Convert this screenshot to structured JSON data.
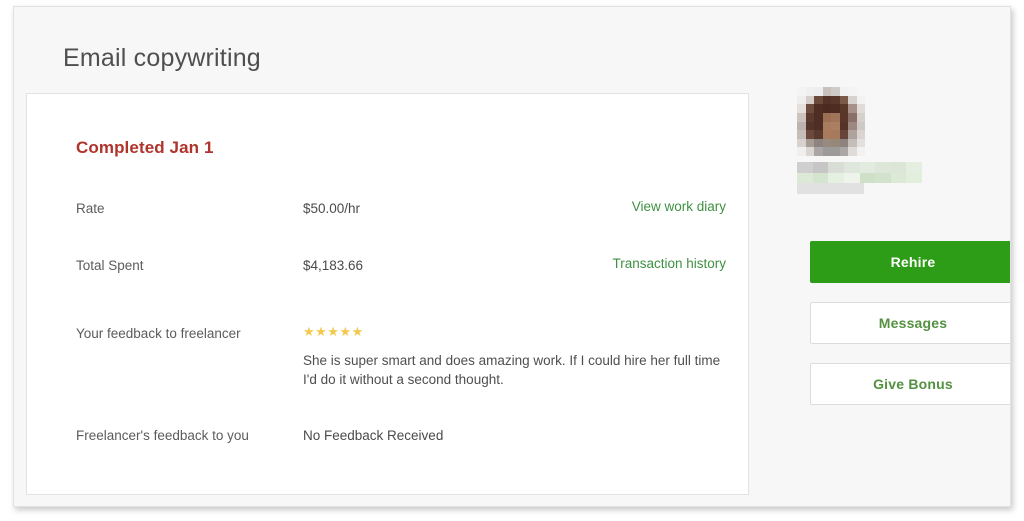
{
  "page": {
    "title": "Email copywriting",
    "background_color": "#f7f7f7"
  },
  "contract": {
    "status_heading": "Completed Jan 1",
    "status_color": "#b0342c",
    "rows": [
      {
        "label": "Rate",
        "value": "$50.00/hr",
        "link": "View work diary"
      },
      {
        "label": "Total Spent",
        "value": "$4,183.66",
        "link": "Transaction history"
      },
      {
        "label": "Your feedback to freelancer",
        "rating": "★★★★★",
        "rating_value": 5,
        "rating_color": "#f5cc3e",
        "comment": "She is super smart and does amazing work. If I could hire her full time I'd do it without a second thought."
      },
      {
        "label": "Freelancer's feedback to you",
        "value": "No Feedback Received"
      }
    ]
  },
  "sidebar": {
    "avatar": "redacted-avatar-image",
    "freelancer_name": "redacted-name-link",
    "freelancer_subtitle": "redacted-subtitle",
    "buttons": [
      {
        "label": "Rehire",
        "style": "primary",
        "color": "#2d9c16"
      },
      {
        "label": "Messages",
        "style": "secondary",
        "color": "#539141"
      },
      {
        "label": "Give Bonus",
        "style": "secondary",
        "color": "#539141"
      }
    ]
  },
  "link_color": "#3f9142"
}
